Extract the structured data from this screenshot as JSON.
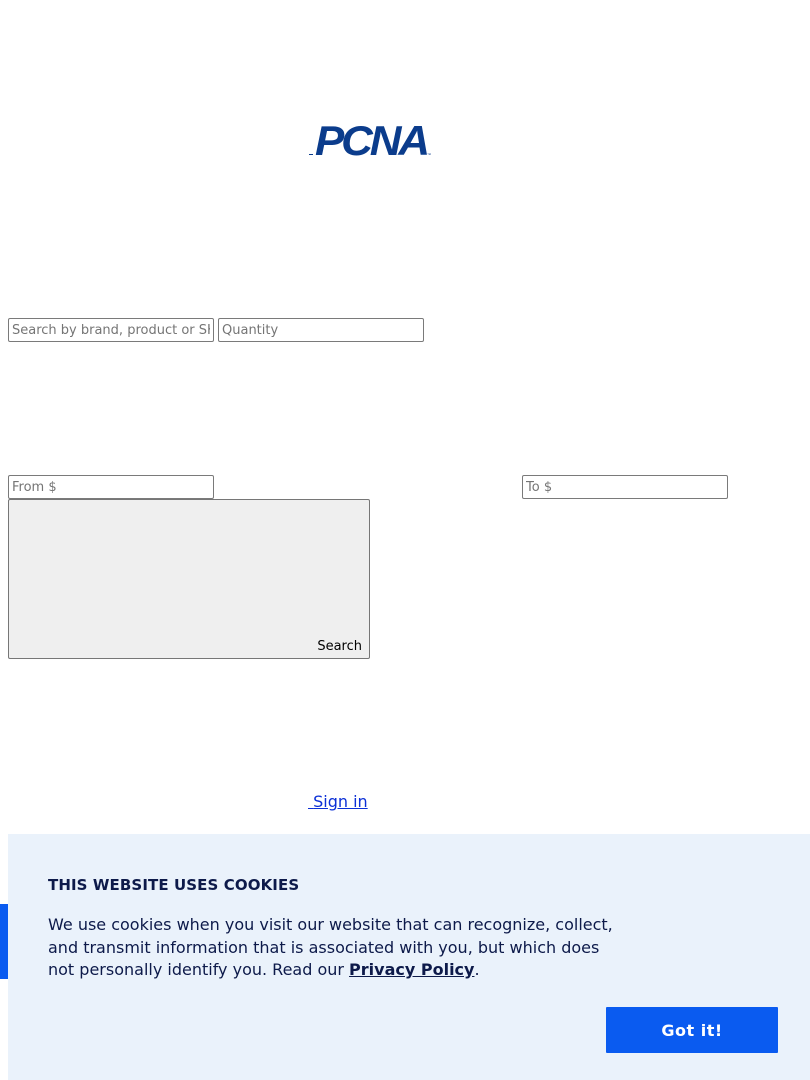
{
  "header": {
    "logo_text": "PCNA",
    "logo_color": "#0b3c8c"
  },
  "search": {
    "keyword_placeholder": "Search by brand, product or SKU",
    "quantity_placeholder": "Quantity",
    "price_from_placeholder": "From $",
    "price_to_placeholder": "To $",
    "button_label": "Search"
  },
  "account": {
    "signin_label": "Sign in"
  },
  "cookie_banner": {
    "title": "THIS WEBSITE USES COOKIES",
    "body": "We use cookies when you visit our website that can recognize, collect, and transmit information that is associated with you, but which does not personally identify you. Read our ",
    "policy_link": "Privacy Policy",
    "body_end": ".",
    "accept_label": "Got it!",
    "background": "#eaf2fb",
    "accent": "#0a5bf0",
    "text_color": "#0d1a4a"
  }
}
